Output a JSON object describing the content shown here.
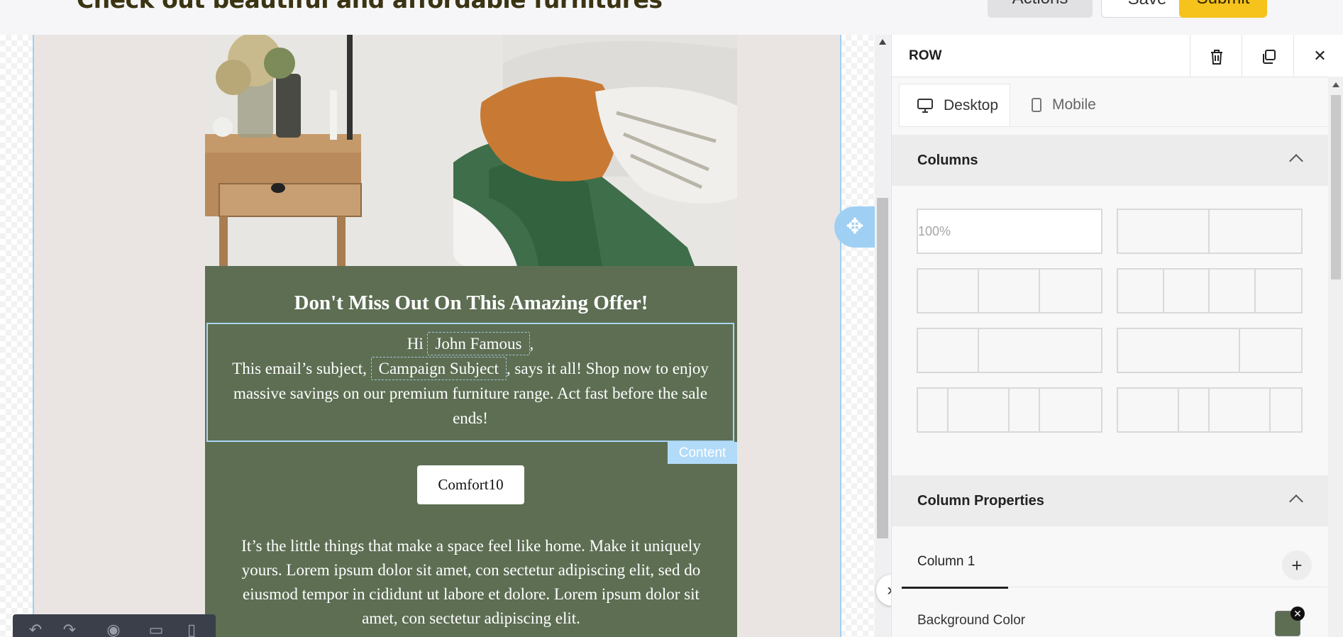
{
  "header": {
    "title": "Check out beautiful and affordable furnitures",
    "actions_label": "Actions",
    "save_label": "Save",
    "submit_label": "Submit"
  },
  "email": {
    "headline": "Don't Miss Out On This Amazing Offer!",
    "greeting_prefix": "Hi",
    "name_tag": "John Famous",
    "greeting_suffix": ",",
    "subject_prefix": "This email’s subject,",
    "subject_tag": "Campaign Subject",
    "subject_suffix": ", says it all! Shop now to enjoy massive savings on our premium furniture range. Act fast before the sale ends!",
    "content_label": "Content",
    "coupon_code": "Comfort10",
    "body_text": "It’s the little things that make a space feel like home. Make it uniquely yours. Lorem ipsum dolor sit amet, con sectetur adipiscing elit, sed do eiusmod tempor in cididunt ut labore et dolore. Lorem ipsum dolor sit amet, con sectetur adipiscing elit.",
    "background_color": "#5d6e53"
  },
  "panel": {
    "title": "ROW",
    "tabs": [
      {
        "label": "Desktop",
        "icon": "monitor-icon",
        "active": true
      },
      {
        "label": "Mobile",
        "icon": "phone-icon",
        "active": false
      }
    ],
    "columns_section": {
      "title": "Columns",
      "first_layout_label": "100%"
    },
    "column_properties": {
      "title": "Column Properties",
      "column_tab": "Column 1",
      "background_color_label": "Background Color",
      "background_color": "#5d6e53"
    }
  },
  "colors": {
    "accent_yellow": "#f6c21c",
    "selection_blue": "#9fd0f3",
    "email_green": "#5d6e53"
  }
}
